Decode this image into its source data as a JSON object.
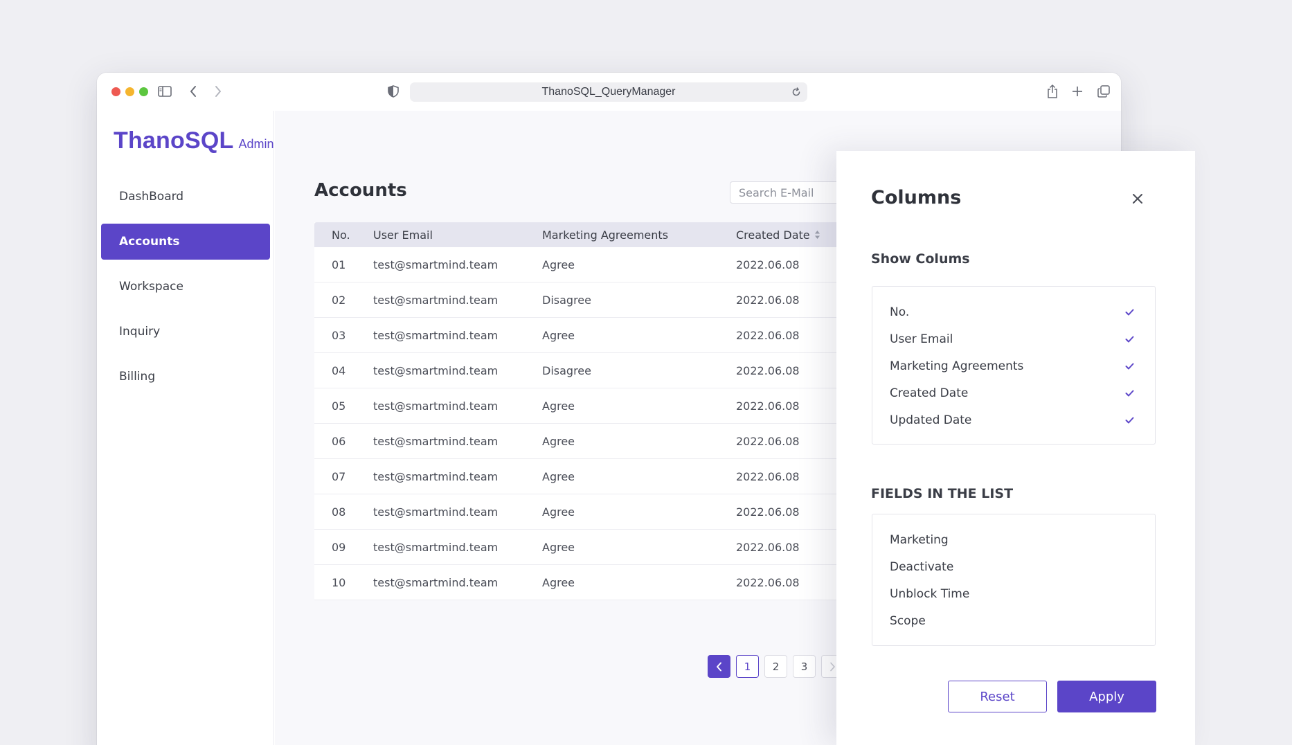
{
  "browser": {
    "url": "ThanoSQL_QueryManager"
  },
  "sidebar": {
    "logo": "ThanoSQL",
    "logo_sub": "Admin",
    "items": [
      {
        "label": "DashBoard",
        "active": false
      },
      {
        "label": "Accounts",
        "active": true
      },
      {
        "label": "Workspace",
        "active": false
      },
      {
        "label": "Inquiry",
        "active": false
      },
      {
        "label": "Billing",
        "active": false
      }
    ]
  },
  "main": {
    "title": "Accounts",
    "search_placeholder": "Search E-Mail",
    "table": {
      "headers": [
        "No.",
        "User Email",
        "Marketing Agreements",
        "Created Date"
      ],
      "rows": [
        [
          "01",
          "test@smartmind.team",
          "Agree",
          "2022.06.08"
        ],
        [
          "02",
          "test@smartmind.team",
          "Disagree",
          "2022.06.08"
        ],
        [
          "03",
          "test@smartmind.team",
          "Agree",
          "2022.06.08"
        ],
        [
          "04",
          "test@smartmind.team",
          "Disagree",
          "2022.06.08"
        ],
        [
          "05",
          "test@smartmind.team",
          "Agree",
          "2022.06.08"
        ],
        [
          "06",
          "test@smartmind.team",
          "Agree",
          "2022.06.08"
        ],
        [
          "07",
          "test@smartmind.team",
          "Agree",
          "2022.06.08"
        ],
        [
          "08",
          "test@smartmind.team",
          "Agree",
          "2022.06.08"
        ],
        [
          "09",
          "test@smartmind.team",
          "Agree",
          "2022.06.08"
        ],
        [
          "10",
          "test@smartmind.team",
          "Agree",
          "2022.06.08"
        ]
      ]
    },
    "pagination": {
      "pages": [
        "1",
        "2",
        "3"
      ],
      "current": "1"
    }
  },
  "panel": {
    "title": "Columns",
    "show_title": "Show Colums",
    "show_columns": [
      {
        "label": "No.",
        "checked": true
      },
      {
        "label": "User Email",
        "checked": true
      },
      {
        "label": "Marketing Agreements",
        "checked": true
      },
      {
        "label": "Created Date",
        "checked": true
      },
      {
        "label": "Updated Date",
        "checked": true
      }
    ],
    "fields_title": "FIELDS IN THE LIST",
    "fields": [
      "Marketing",
      "Deactivate",
      "Unblock Time",
      "Scope"
    ],
    "reset_label": "Reset",
    "apply_label": "Apply"
  },
  "colors": {
    "accent": "#5b45c8",
    "background": "#efeff3",
    "table_header": "#e5e5ef"
  },
  "icons": {
    "window_controls": [
      "close-dot",
      "minimize-dot",
      "maximize-dot"
    ],
    "toolbar_left": [
      "sidebar-toggle-icon",
      "back-icon",
      "forward-icon"
    ],
    "url_bar": [
      "shield-icon",
      "reload-icon"
    ],
    "toolbar_right": [
      "share-icon",
      "new-tab-icon",
      "tabs-overview-icon"
    ],
    "table": [
      "sort-icon"
    ],
    "pagination": [
      "chevron-left-icon",
      "chevron-right-icon"
    ],
    "panel": [
      "close-icon",
      "check-icon"
    ]
  }
}
